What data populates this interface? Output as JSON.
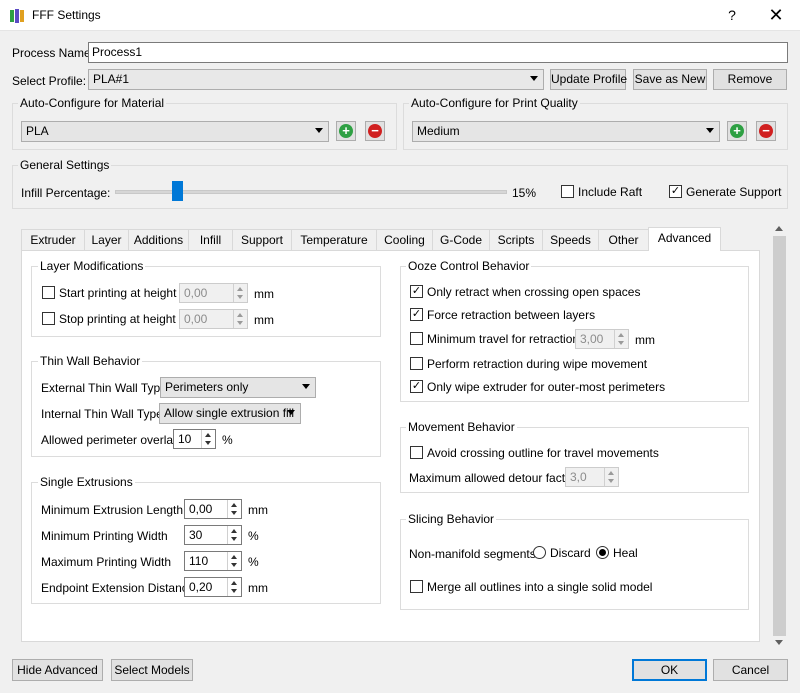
{
  "window": {
    "title": "FFF Settings",
    "help": "?",
    "close": "✕"
  },
  "process": {
    "label": "Process Name:",
    "value": "Process1"
  },
  "profile": {
    "label": "Select Profile:",
    "value": "PLA#1",
    "update": "Update Profile",
    "save_as_new": "Save as New",
    "remove": "Remove"
  },
  "material": {
    "title": "Auto-Configure for Material",
    "value": "PLA",
    "add": "+",
    "remove": "−"
  },
  "quality": {
    "title": "Auto-Configure for Print Quality",
    "value": "Medium",
    "add": "+",
    "remove": "−"
  },
  "general": {
    "title": "General Settings",
    "infill_label": "Infill Percentage:",
    "infill_value": "15%",
    "infill_fraction": 0.15,
    "include_raft": {
      "label": "Include Raft",
      "checked": false
    },
    "generate_support": {
      "label": "Generate Support",
      "checked": true
    }
  },
  "tabs": [
    "Extruder",
    "Layer",
    "Additions",
    "Infill",
    "Support",
    "Temperature",
    "Cooling",
    "G-Code",
    "Scripts",
    "Speeds",
    "Other",
    "Advanced"
  ],
  "active_tab": "Advanced",
  "layer_mod": {
    "title": "Layer Modifications",
    "start": {
      "label": "Start printing at height",
      "value": "0,00",
      "unit": "mm",
      "checked": false
    },
    "stop": {
      "label": "Stop printing at height",
      "value": "0,00",
      "unit": "mm",
      "checked": false
    }
  },
  "thin_wall": {
    "title": "Thin Wall Behavior",
    "external_label": "External Thin Wall Type",
    "external_value": "Perimeters only",
    "internal_label": "Internal Thin Wall Type",
    "internal_value": "Allow single extrusion fill",
    "overlap_label": "Allowed perimeter overlap",
    "overlap_value": "10",
    "overlap_unit": "%"
  },
  "single_ext": {
    "title": "Single Extrusions",
    "rows": [
      {
        "label": "Minimum Extrusion Length",
        "value": "0,00",
        "unit": "mm"
      },
      {
        "label": "Minimum Printing Width",
        "value": "30",
        "unit": "%"
      },
      {
        "label": "Maximum Printing Width",
        "value": "110",
        "unit": "%"
      },
      {
        "label": "Endpoint Extension Distance",
        "value": "0,20",
        "unit": "mm"
      }
    ]
  },
  "ooze": {
    "title": "Ooze Control Behavior",
    "only_retract": {
      "label": "Only retract when crossing open spaces",
      "checked": true
    },
    "force_retract": {
      "label": "Force retraction between layers",
      "checked": true
    },
    "min_travel": {
      "label": "Minimum travel for retraction",
      "value": "3,00",
      "unit": "mm",
      "checked": false
    },
    "wipe_retract": {
      "label": "Perform retraction during wipe movement",
      "checked": false
    },
    "only_wipe": {
      "label": "Only wipe extruder for outer-most perimeters",
      "checked": true
    }
  },
  "movement": {
    "title": "Movement Behavior",
    "avoid": {
      "label": "Avoid crossing outline for travel movements",
      "checked": false
    },
    "detour_label": "Maximum allowed detour factor",
    "detour_value": "3,0"
  },
  "slicing": {
    "title": "Slicing Behavior",
    "nonmanifold_label": "Non-manifold segments:",
    "discard": "Discard",
    "heal": "Heal",
    "selected": "Heal",
    "merge": {
      "label": "Merge all outlines into a single solid model",
      "checked": false
    }
  },
  "footer": {
    "hide_advanced": "Hide Advanced",
    "select_models": "Select Models",
    "ok": "OK",
    "cancel": "Cancel"
  },
  "colors": {
    "accent": "#0078d7",
    "add": "#2ea043",
    "remove": "#d01f1f",
    "slider_thumb": "#0078d7"
  }
}
